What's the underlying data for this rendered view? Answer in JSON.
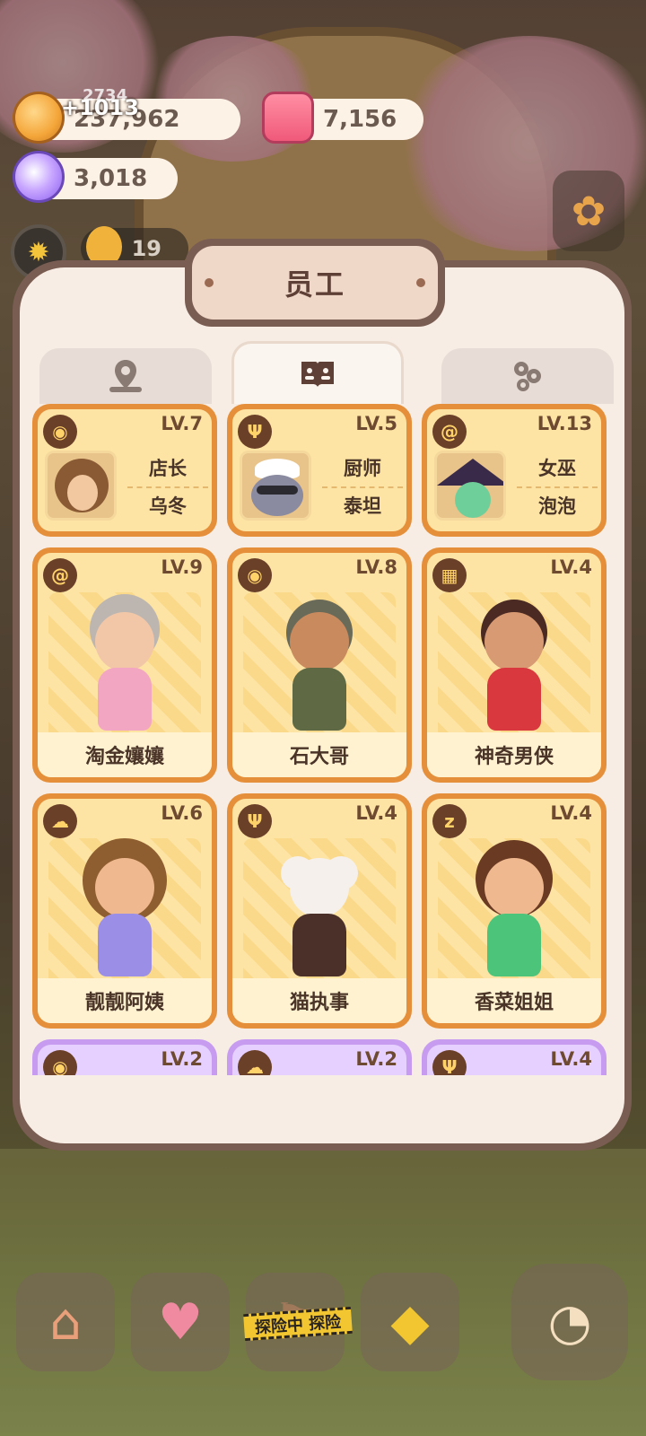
{
  "resources": {
    "coins": "237,962",
    "coin_overlay": "2734",
    "coin_gain": "+1013",
    "candles": "7,156",
    "gems": "3,018",
    "staff_count": "19"
  },
  "panel": {
    "title": "员工"
  },
  "tabs": [
    {
      "icon": "map-pin-icon",
      "active": false
    },
    {
      "icon": "book-icon",
      "active": true
    },
    {
      "icon": "link-icon",
      "active": false
    }
  ],
  "special_staff": [
    {
      "role": "店长",
      "name": "乌冬",
      "level": "LV.7",
      "icon": "bun-icon"
    },
    {
      "role": "厨师",
      "name": "泰坦",
      "level": "LV.5",
      "icon": "fork-knife-icon"
    },
    {
      "role": "女巫",
      "name": "泡泡",
      "level": "LV.13",
      "icon": "swirl-icon"
    }
  ],
  "staff": [
    {
      "name": "淘金孃孃",
      "level": "LV.9",
      "icon": "swirl-icon"
    },
    {
      "name": "石大哥",
      "level": "LV.8",
      "icon": "bun-icon"
    },
    {
      "name": "神奇男侠",
      "level": "LV.4",
      "icon": "clapper-icon"
    },
    {
      "name": "靓靓阿姨",
      "level": "LV.6",
      "icon": "cloud-icon"
    },
    {
      "name": "猫执事",
      "level": "LV.4",
      "icon": "fork-knife-icon"
    },
    {
      "name": "香菜姐姐",
      "level": "LV.4",
      "icon": "sleep-icon"
    }
  ],
  "partial_row": [
    {
      "level": "LV.2"
    },
    {
      "level": "LV.2"
    },
    {
      "level": "LV.4"
    }
  ],
  "bottom_nav": {
    "adventure_tape": "探险中 探险"
  }
}
